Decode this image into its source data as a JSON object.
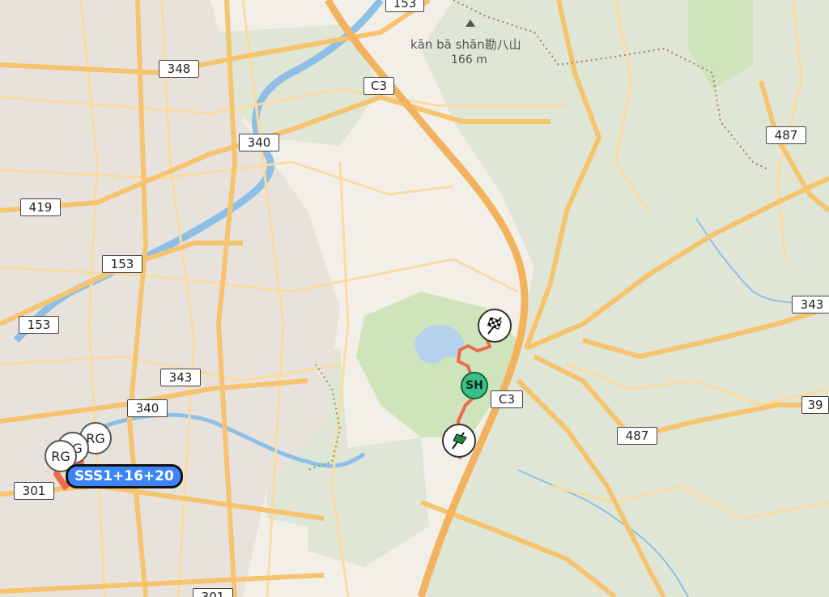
{
  "map": {
    "colors": {
      "land": "#f2efe9",
      "forest": "#dfe6d6",
      "park": "#cfe4bb",
      "urban": "#e7e3dc",
      "water": "#b4d2ec",
      "river": "#8ec0e6",
      "road_major": "#f6c46f",
      "road_minor": "#fbdba0",
      "expressway": "#f3b25e",
      "route": "#ef6a4c",
      "trail": "#b07a6a",
      "stage_badge": "#3d85f5",
      "service_marker": "#3bbf8a"
    },
    "route_shields": [
      "153",
      "348",
      "C3",
      "340",
      "487",
      "419",
      "153",
      "153",
      "343",
      "343",
      "C3",
      "340",
      "487",
      "39",
      "301",
      "301"
    ],
    "peak": {
      "name": "kān bā shān勘八山",
      "elevation": "166 m",
      "icon": "mountain-peak-icon"
    },
    "markers": [
      {
        "type": "checkered-flag",
        "icon": "checkered-flag-icon"
      },
      {
        "type": "service",
        "label": "SH"
      },
      {
        "type": "start-flag",
        "icon": "green-flag-icon"
      },
      {
        "type": "regroup",
        "label": "RG"
      },
      {
        "type": "regroup",
        "label": "RG"
      },
      {
        "type": "regroup",
        "label": "RG"
      }
    ],
    "stage_label": "SSS1+16+20"
  }
}
